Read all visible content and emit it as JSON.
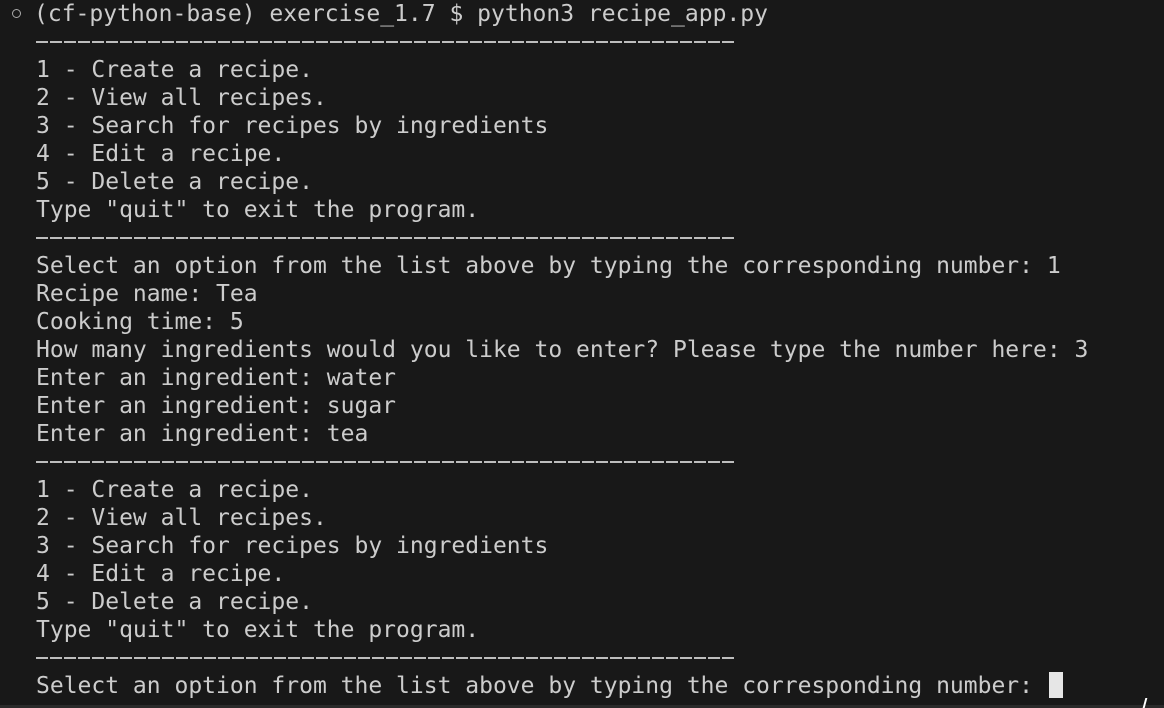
{
  "prompt": {
    "environment": "(cf-python-base)",
    "directory": "exercise_1.7",
    "symbol": "$",
    "command": "python3 recipe_app.py"
  },
  "menu1": {
    "items": [
      "1 - Create a recipe.",
      "2 - View all recipes.",
      "3 - Search for recipes by ingredients",
      "4 - Edit a recipe.",
      "5 - Delete a recipe."
    ],
    "quit_hint": "Type \"quit\" to exit the program."
  },
  "session": {
    "select_prompt": "Select an option from the list above by typing the corresponding number: 1",
    "recipe_name": "Recipe name: Tea",
    "cooking_time": "Cooking time: 5",
    "ingredient_count": "How many ingredients would you like to enter? Please type the number here: 3",
    "ingredients": [
      "Enter an ingredient: water",
      "Enter an ingredient: sugar",
      "Enter an ingredient: tea"
    ]
  },
  "menu2": {
    "items": [
      "1 - Create a recipe.",
      "2 - View all recipes.",
      "3 - Search for recipes by ingredients",
      "4 - Edit a recipe.",
      "5 - Delete a recipe."
    ],
    "quit_hint": "Type \"quit\" to exit the program."
  },
  "final_prompt": "Select an option from the list above by typing the corresponding number: ",
  "colors": {
    "background": "#181818",
    "text": "#cccccc",
    "cursor": "#e6e6e6"
  }
}
